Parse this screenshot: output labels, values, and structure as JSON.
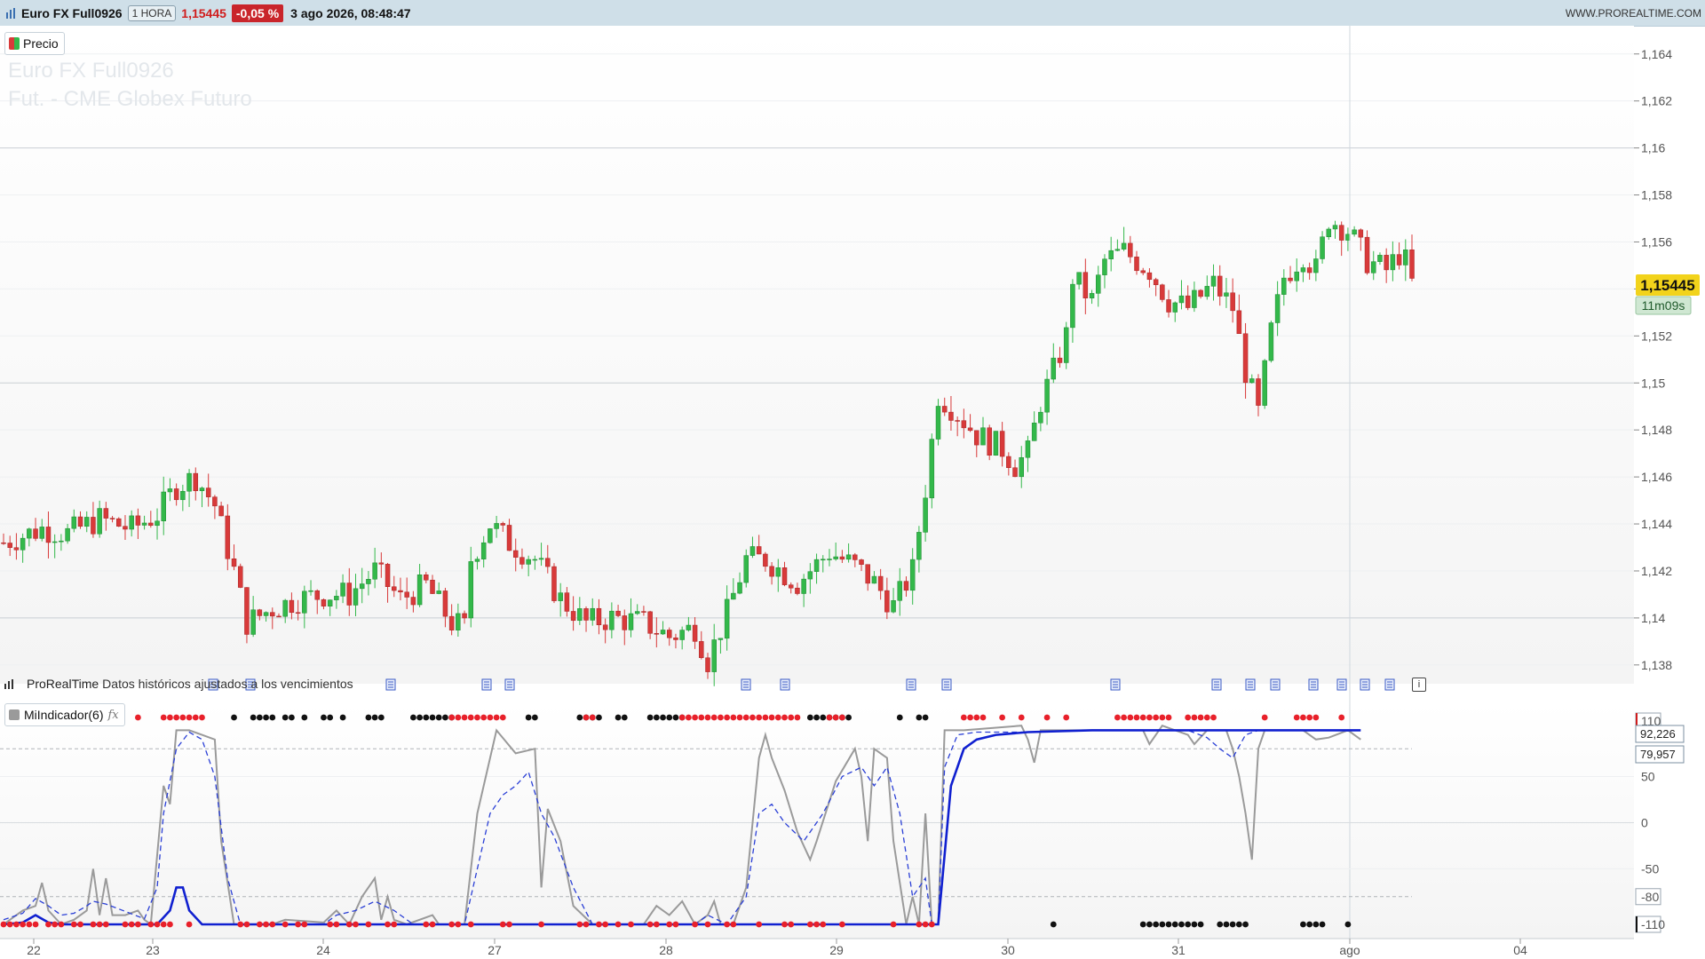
{
  "header": {
    "instrument": "Euro FX Full0926",
    "timeframe": "1 HORA",
    "last_price": "1,15445",
    "change": "-0,05 %",
    "datetime": "3 ago 2026, 08:48:47",
    "website": "WWW.PROREALTIME.COM"
  },
  "price_panel": {
    "legend_label": "Precio",
    "watermark_line1": "Euro FX Full0926",
    "watermark_line2": "Fut. - CME Globex  Futuro",
    "current_price_badge": "1,15445",
    "countdown_badge": "11m09s",
    "y_axis_ticks": [
      "1,164",
      "1,162",
      "1,16",
      "1,158",
      "1,156",
      "1,154",
      "1,152",
      "1,15",
      "1,148",
      "1,146",
      "1,144",
      "1,142",
      "1,14",
      "1,138"
    ]
  },
  "source_note": {
    "brand": "ProRealTime",
    "text": "Datos históricos ajustados a los vencimientos"
  },
  "indicator_panel": {
    "legend_label": "MiIndicador(6)",
    "y_axis_ticks": [
      "110",
      "50",
      "0",
      "-50",
      "-80",
      "-110"
    ],
    "value_badges": [
      "92,226",
      "79,957"
    ]
  },
  "x_axis": {
    "labels": [
      "22",
      "23",
      "24",
      "27",
      "28",
      "29",
      "30",
      "31",
      "ago",
      "04"
    ]
  },
  "colors": {
    "up_candle": "#33b84a",
    "down_candle": "#d83a3a",
    "price_badge": "#f2d31b",
    "countdown_badge": "#cfe7d2",
    "indicator_main": "#9a9a9a",
    "indicator_signal": "#2a3fd6",
    "indicator_thick": "#1020d0",
    "header_bg": "#cfdfe8",
    "change_badge": "#c9252b"
  },
  "icons": [
    "bars-logo-icon",
    "document-event-icon",
    "info-icon",
    "fx-formula-icon"
  ],
  "chart_data": [
    {
      "type": "candlestick",
      "series": [
        {
          "name": "Precio"
        }
      ],
      "x_labels": [
        "22",
        "23",
        "24",
        "27",
        "28",
        "29",
        "30",
        "31",
        "ago",
        "04"
      ],
      "ylim": [
        1.1372,
        1.1652
      ],
      "grid": true,
      "price_path": [
        [
          0,
          1.1432
        ],
        [
          6,
          1.1438
        ],
        [
          10,
          1.1436
        ],
        [
          15,
          1.1442
        ],
        [
          20,
          1.1438
        ],
        [
          24,
          1.1444
        ],
        [
          27,
          1.1456
        ],
        [
          30,
          1.146
        ],
        [
          33,
          1.1448
        ],
        [
          36,
          1.142
        ],
        [
          38,
          1.1398
        ],
        [
          42,
          1.1404
        ],
        [
          46,
          1.1408
        ],
        [
          50,
          1.141
        ],
        [
          54,
          1.141
        ],
        [
          58,
          1.142
        ],
        [
          62,
          1.1408
        ],
        [
          66,
          1.1414
        ],
        [
          70,
          1.1398
        ],
        [
          72,
          1.1396
        ],
        [
          73,
          1.1425
        ],
        [
          76,
          1.144
        ],
        [
          79,
          1.1432
        ],
        [
          83,
          1.1425
        ],
        [
          87,
          1.1408
        ],
        [
          91,
          1.1398
        ],
        [
          95,
          1.14
        ],
        [
          100,
          1.1398
        ],
        [
          104,
          1.1392
        ],
        [
          108,
          1.1396
        ],
        [
          110,
          1.1382
        ],
        [
          113,
          1.1402
        ],
        [
          116,
          1.1425
        ],
        [
          119,
          1.1425
        ],
        [
          124,
          1.1415
        ],
        [
          129,
          1.1428
        ],
        [
          133,
          1.1422
        ],
        [
          136,
          1.1415
        ],
        [
          139,
          1.1405
        ],
        [
          142,
          1.142
        ],
        [
          144,
          1.1455
        ],
        [
          146,
          1.1495
        ],
        [
          148,
          1.149
        ],
        [
          152,
          1.1478
        ],
        [
          156,
          1.1472
        ],
        [
          158,
          1.1465
        ],
        [
          160,
          1.147
        ],
        [
          162,
          1.1492
        ],
        [
          164,
          1.1505
        ],
        [
          166,
          1.152
        ],
        [
          167,
          1.1545
        ],
        [
          170,
          1.1535
        ],
        [
          172,
          1.1552
        ],
        [
          175,
          1.1556
        ],
        [
          179,
          1.1548
        ],
        [
          182,
          1.1535
        ],
        [
          185,
          1.1532
        ],
        [
          189,
          1.1542
        ],
        [
          192,
          1.1532
        ],
        [
          194,
          1.1505
        ],
        [
          196,
          1.1487
        ],
        [
          198,
          1.1522
        ],
        [
          200,
          1.1545
        ],
        [
          203,
          1.1555
        ],
        [
          205,
          1.1548
        ],
        [
          207,
          1.157
        ],
        [
          210,
          1.1565
        ],
        [
          213,
          1.1552
        ],
        [
          216,
          1.1548
        ],
        [
          218,
          1.1555
        ],
        [
          220,
          1.1548
        ]
      ],
      "last": 1.15445
    },
    {
      "type": "line",
      "series": [
        {
          "name": "MiIndicador(6)"
        }
      ],
      "ylim": [
        -110,
        110
      ],
      "reference_levels": [
        80,
        -80
      ],
      "main_line": [
        [
          0,
          -110
        ],
        [
          3,
          -95
        ],
        [
          5,
          -90
        ],
        [
          6,
          -65
        ],
        [
          7,
          -95
        ],
        [
          9,
          -110
        ],
        [
          11,
          -105
        ],
        [
          13,
          -95
        ],
        [
          14,
          -50
        ],
        [
          15,
          -100
        ],
        [
          16,
          -60
        ],
        [
          17,
          -100
        ],
        [
          19,
          -100
        ],
        [
          21,
          -95
        ],
        [
          22,
          -105
        ],
        [
          23,
          -110
        ],
        [
          25,
          40
        ],
        [
          26,
          20
        ],
        [
          27,
          100
        ],
        [
          29,
          100
        ],
        [
          31,
          95
        ],
        [
          33,
          90
        ],
        [
          34,
          -20
        ],
        [
          36,
          -110
        ],
        [
          42,
          -110
        ],
        [
          44,
          -105
        ],
        [
          50,
          -108
        ],
        [
          52,
          -95
        ],
        [
          54,
          -110
        ],
        [
          56,
          -80
        ],
        [
          58,
          -60
        ],
        [
          59,
          -105
        ],
        [
          60,
          -80
        ],
        [
          61,
          -105
        ],
        [
          63,
          -110
        ],
        [
          67,
          -100
        ],
        [
          68,
          -110
        ],
        [
          72,
          -110
        ],
        [
          74,
          10
        ],
        [
          77,
          100
        ],
        [
          80,
          75
        ],
        [
          83,
          80
        ],
        [
          84,
          -70
        ],
        [
          85,
          15
        ],
        [
          87,
          -20
        ],
        [
          89,
          -90
        ],
        [
          92,
          -110
        ],
        [
          100,
          -110
        ],
        [
          102,
          -90
        ],
        [
          104,
          -100
        ],
        [
          106,
          -85
        ],
        [
          108,
          -110
        ],
        [
          110,
          -100
        ],
        [
          111,
          -85
        ],
        [
          112,
          -110
        ],
        [
          114,
          -110
        ],
        [
          116,
          -70
        ],
        [
          118,
          70
        ],
        [
          119,
          95
        ],
        [
          120,
          70
        ],
        [
          122,
          35
        ],
        [
          124,
          -10
        ],
        [
          126,
          -40
        ],
        [
          127,
          -20
        ],
        [
          130,
          45
        ],
        [
          133,
          80
        ],
        [
          134,
          50
        ],
        [
          135,
          -20
        ],
        [
          136,
          80
        ],
        [
          137,
          75
        ],
        [
          138,
          70
        ],
        [
          139,
          -20
        ],
        [
          141,
          -110
        ],
        [
          142,
          -80
        ],
        [
          143,
          -110
        ],
        [
          144,
          10
        ],
        [
          145,
          -110
        ],
        [
          146,
          -110
        ],
        [
          147,
          100
        ],
        [
          150,
          100
        ],
        [
          159,
          105
        ],
        [
          160,
          90
        ],
        [
          161,
          65
        ],
        [
          162,
          100
        ],
        [
          169,
          100
        ],
        [
          178,
          100
        ],
        [
          179,
          85
        ],
        [
          181,
          105
        ],
        [
          185,
          95
        ],
        [
          186,
          85
        ],
        [
          188,
          100
        ],
        [
          191,
          100
        ],
        [
          192,
          80
        ],
        [
          193,
          50
        ],
        [
          194,
          10
        ],
        [
          195,
          -40
        ],
        [
          196,
          80
        ],
        [
          197,
          100
        ],
        [
          203,
          100
        ],
        [
          205,
          90
        ],
        [
          207,
          92
        ],
        [
          210,
          100
        ],
        [
          212,
          90
        ]
      ],
      "signal_line": [
        [
          0,
          -105
        ],
        [
          3,
          -98
        ],
        [
          5,
          -82
        ],
        [
          7,
          -90
        ],
        [
          9,
          -100
        ],
        [
          11,
          -98
        ],
        [
          13,
          -90
        ],
        [
          14,
          -85
        ],
        [
          16,
          -88
        ],
        [
          19,
          -96
        ],
        [
          22,
          -104
        ],
        [
          24,
          -70
        ],
        [
          25,
          10
        ],
        [
          27,
          80
        ],
        [
          29,
          98
        ],
        [
          31,
          90
        ],
        [
          33,
          50
        ],
        [
          35,
          -60
        ],
        [
          37,
          -110
        ],
        [
          50,
          -110
        ],
        [
          52,
          -100
        ],
        [
          55,
          -95
        ],
        [
          58,
          -85
        ],
        [
          61,
          -95
        ],
        [
          64,
          -110
        ],
        [
          72,
          -110
        ],
        [
          74,
          -50
        ],
        [
          76,
          10
        ],
        [
          78,
          30
        ],
        [
          80,
          40
        ],
        [
          82,
          55
        ],
        [
          84,
          10
        ],
        [
          86,
          -15
        ],
        [
          89,
          -70
        ],
        [
          92,
          -110
        ],
        [
          108,
          -110
        ],
        [
          110,
          -100
        ],
        [
          113,
          -110
        ],
        [
          116,
          -80
        ],
        [
          118,
          10
        ],
        [
          120,
          20
        ],
        [
          122,
          0
        ],
        [
          125,
          -20
        ],
        [
          128,
          10
        ],
        [
          131,
          50
        ],
        [
          134,
          60
        ],
        [
          136,
          40
        ],
        [
          138,
          60
        ],
        [
          140,
          10
        ],
        [
          142,
          -80
        ],
        [
          144,
          -60
        ],
        [
          145,
          -110
        ],
        [
          146,
          -110
        ],
        [
          147,
          60
        ],
        [
          149,
          95
        ],
        [
          152,
          98
        ],
        [
          160,
          98
        ],
        [
          170,
          100
        ],
        [
          180,
          100
        ],
        [
          185,
          100
        ],
        [
          188,
          92
        ],
        [
          190,
          80
        ],
        [
          192,
          70
        ],
        [
          194,
          95
        ],
        [
          196,
          100
        ],
        [
          212,
          100
        ]
      ],
      "thick_line": [
        [
          0,
          -110
        ],
        [
          3,
          -108
        ],
        [
          5,
          -100
        ],
        [
          7,
          -108
        ],
        [
          9,
          -110
        ],
        [
          24,
          -110
        ],
        [
          26,
          -95
        ],
        [
          27,
          -70
        ],
        [
          28,
          -70
        ],
        [
          29,
          -95
        ],
        [
          31,
          -110
        ],
        [
          146,
          -110
        ],
        [
          148,
          40
        ],
        [
          150,
          80
        ],
        [
          152,
          90
        ],
        [
          155,
          95
        ],
        [
          160,
          98
        ],
        [
          170,
          100
        ],
        [
          212,
          100
        ]
      ]
    }
  ]
}
